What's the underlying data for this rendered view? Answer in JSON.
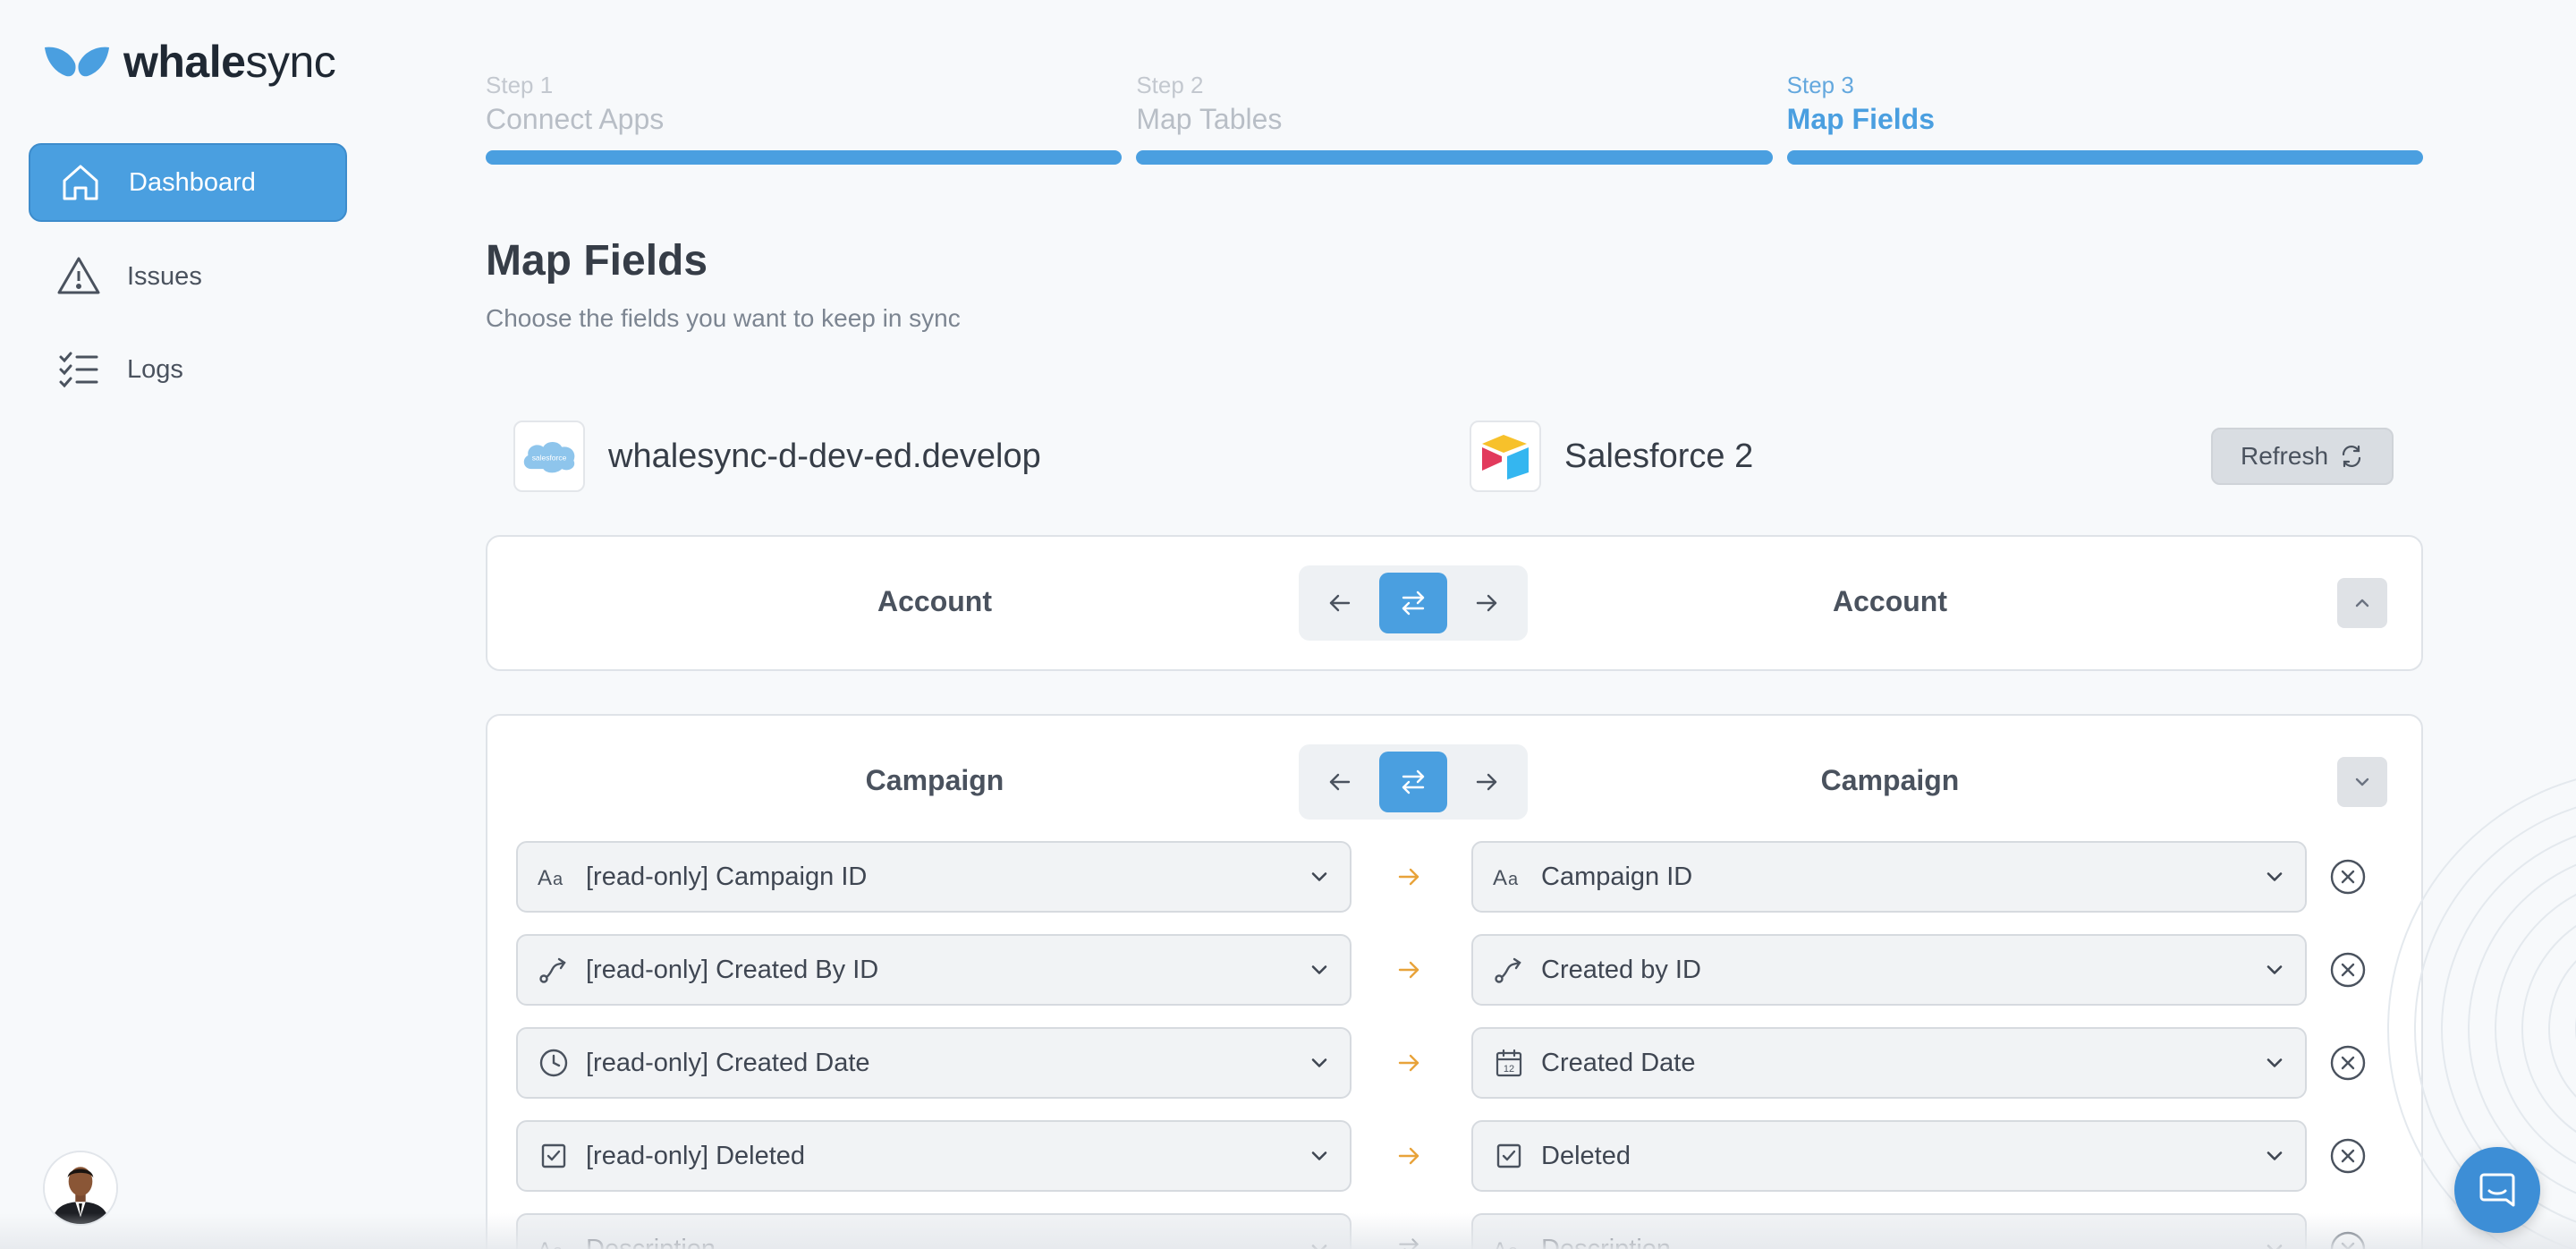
{
  "brand": {
    "logo_text_bold": "whale",
    "logo_text_rest": "sync"
  },
  "sidebar": {
    "items": [
      {
        "label": "Dashboard",
        "icon": "home-icon",
        "active": true
      },
      {
        "label": "Issues",
        "icon": "warning-icon",
        "active": false
      },
      {
        "label": "Logs",
        "icon": "checklist-icon",
        "active": false
      }
    ]
  },
  "steps": [
    {
      "num": "Step 1",
      "title": "Connect Apps",
      "active": false
    },
    {
      "num": "Step 2",
      "title": "Map Tables",
      "active": false
    },
    {
      "num": "Step 3",
      "title": "Map Fields",
      "active": true
    }
  ],
  "page": {
    "title": "Map Fields",
    "subtitle": "Choose the fields you want to keep in sync"
  },
  "apps": {
    "left": {
      "name": "whalesync-d-dev-ed.develop",
      "logo": "salesforce-logo",
      "logo_text": "salesforce"
    },
    "right": {
      "name": "Salesforce 2",
      "logo": "airtable-logo"
    },
    "refresh_label": "Refresh"
  },
  "tables": [
    {
      "left": "Account",
      "right": "Account",
      "direction": "two-way",
      "expanded": false
    },
    {
      "left": "Campaign",
      "right": "Campaign",
      "direction": "two-way",
      "expanded": true,
      "fields": [
        {
          "left": "[read-only] Campaign ID",
          "left_icon": "text-icon",
          "right": "Campaign ID",
          "right_icon": "text-icon",
          "direction": "right"
        },
        {
          "left": "[read-only] Created By ID",
          "left_icon": "link-icon",
          "right": "Created by ID",
          "right_icon": "link-icon",
          "direction": "right"
        },
        {
          "left": "[read-only] Created Date",
          "left_icon": "clock-icon",
          "right": "Created Date",
          "right_icon": "calendar-icon",
          "direction": "right"
        },
        {
          "left": "[read-only] Deleted",
          "left_icon": "checkbox-icon",
          "right": "Deleted",
          "right_icon": "checkbox-icon",
          "direction": "right"
        },
        {
          "left": "Description",
          "left_icon": "text-icon",
          "right": "Description",
          "right_icon": "text-icon",
          "direction": "two-way"
        }
      ]
    }
  ],
  "colors": {
    "accent": "#4a9fe0",
    "one_way_arrow": "#e8a33a",
    "chat": "#3d8ed6"
  }
}
